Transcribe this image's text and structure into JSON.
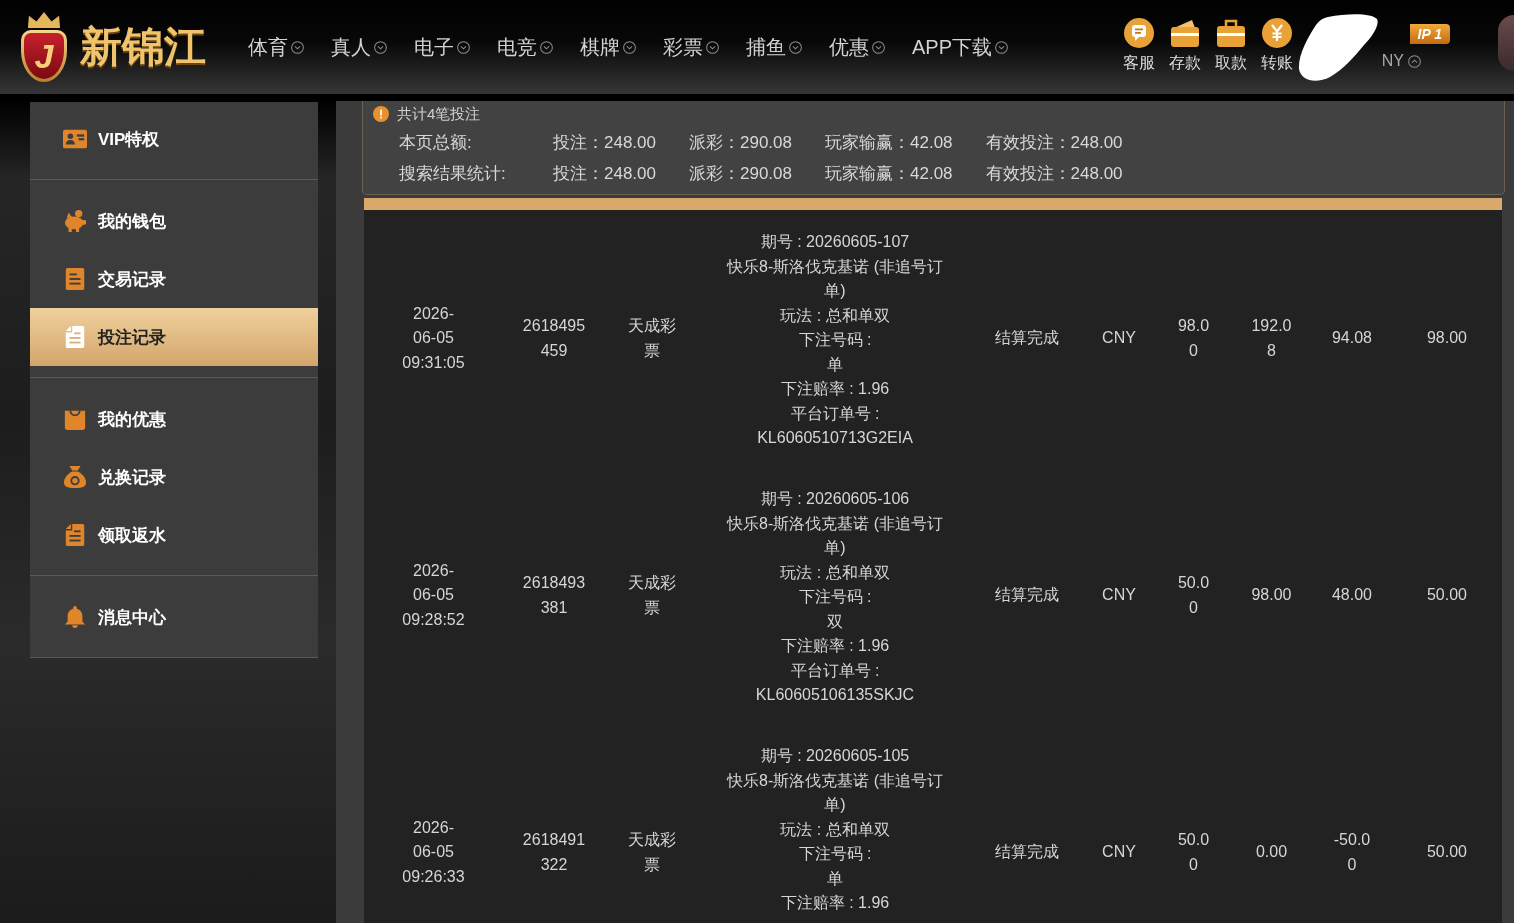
{
  "header": {
    "logo": {
      "letter": "J",
      "name": "新锦江"
    },
    "nav": [
      "体育",
      "真人",
      "电子",
      "电竞",
      "棋牌",
      "彩票",
      "捕鱼",
      "优惠",
      "APP下载"
    ],
    "actions": [
      "客服",
      "存款",
      "取款",
      "转账"
    ],
    "user": {
      "vip_badge": "IP 1",
      "currency": "NY"
    }
  },
  "sidebar": {
    "groups": [
      {
        "items": [
          {
            "label": "VIP特权",
            "selected": false
          }
        ]
      },
      {
        "items": [
          {
            "label": "我的钱包",
            "selected": false
          },
          {
            "label": "交易记录",
            "selected": false
          },
          {
            "label": "投注记录",
            "selected": true
          }
        ]
      },
      {
        "items": [
          {
            "label": "我的优惠",
            "selected": false
          },
          {
            "label": "兑换记录",
            "selected": false
          },
          {
            "label": "领取返水",
            "selected": false
          }
        ]
      },
      {
        "items": [
          {
            "label": "消息中心",
            "selected": false
          }
        ]
      }
    ]
  },
  "summary": {
    "title": "共计4笔投注",
    "rows": [
      {
        "label": "本页总额:",
        "values": [
          "投注：248.00",
          "派彩：290.08",
          "玩家输赢：42.08",
          "有效投注：248.00"
        ]
      },
      {
        "label": "搜索结果统计:",
        "values": [
          "投注：248.00",
          "派彩：290.08",
          "玩家输赢：42.08",
          "有效投注：248.00"
        ]
      }
    ]
  },
  "table": {
    "rows": [
      {
        "column_1": "2026-06-05 09:31:05",
        "column_2": "2618495459",
        "column_3": "天成彩票",
        "column_4": [
          "期号 : 20260605-107",
          "快乐8-斯洛伐克基诺 (非追号订单)",
          "玩法 : 总和单双",
          "下注号码 :",
          "单",
          "下注赔率 : 1.96",
          "平台订单号 :",
          "KL6060510713G2EIA"
        ],
        "column_5": "结算完成",
        "column_6": "CNY",
        "column_7": "98.00",
        "column_8": "192.08",
        "column_9": "94.08",
        "column_10": "98.00"
      },
      {
        "column_1": "2026-06-05 09:28:52",
        "column_2": "2618493381",
        "column_3": "天成彩票",
        "column_4": [
          "期号 : 20260605-106",
          "快乐8-斯洛伐克基诺 (非追号订单)",
          "玩法 : 总和单双",
          "下注号码 :",
          "双",
          "下注赔率 : 1.96",
          "平台订单号 :",
          "KL60605106135SKJC"
        ],
        "column_5": "结算完成",
        "column_6": "CNY",
        "column_7": "50.00",
        "column_8": "98.00",
        "column_9": "48.00",
        "column_10": "50.00"
      },
      {
        "column_1": "2026-06-05 09:26:33",
        "column_2": "2618491322",
        "column_3": "天成彩票",
        "column_4": [
          "期号 : 20260605-105",
          "快乐8-斯洛伐克基诺 (非追号订单)",
          "玩法 : 总和单双",
          "下注号码 :",
          "单",
          "下注赔率 : 1.96"
        ],
        "column_5": "结算完成",
        "column_6": "CNY",
        "column_7": "50.00",
        "column_8": "0.00",
        "column_9": "-50.00",
        "column_10": "50.00"
      }
    ]
  }
}
